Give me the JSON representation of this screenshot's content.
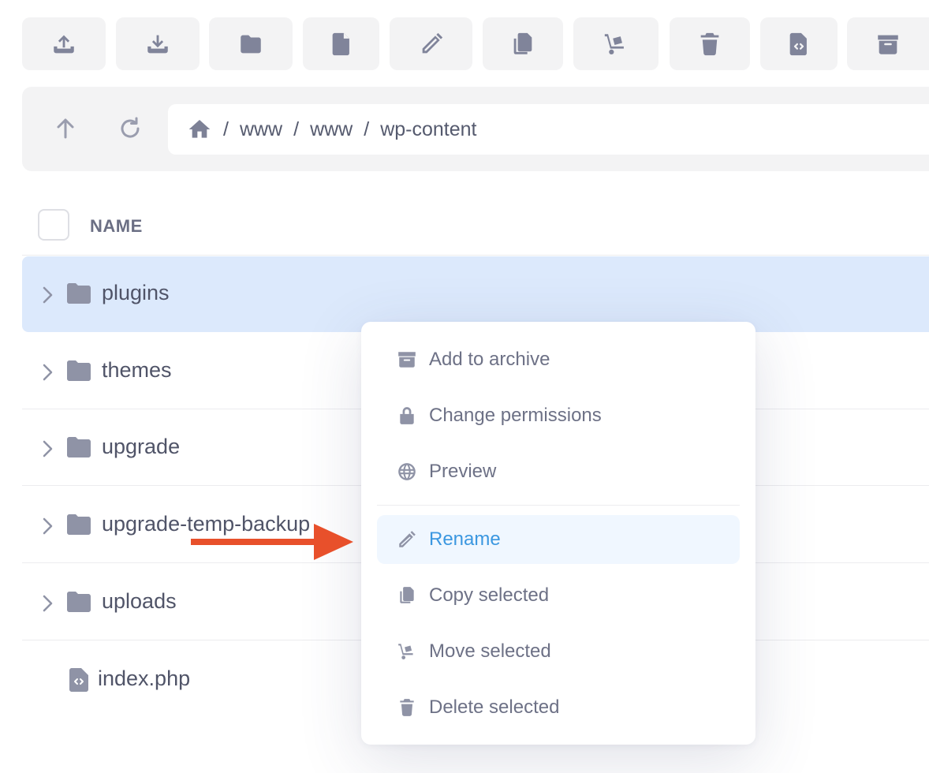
{
  "toolbar": {
    "buttons": [
      {
        "name": "upload-icon"
      },
      {
        "name": "download-icon"
      },
      {
        "name": "new-folder-icon"
      },
      {
        "name": "new-file-icon"
      },
      {
        "name": "rename-pencil-icon"
      },
      {
        "name": "copy-icon"
      },
      {
        "name": "move-dolly-icon"
      },
      {
        "name": "trash-icon"
      },
      {
        "name": "code-file-icon"
      },
      {
        "name": "archive-icon"
      }
    ],
    "icon_color": "#80849a",
    "button_bg": "#f3f3f4"
  },
  "address": {
    "crumbs": [
      "www",
      "www",
      "wp-content"
    ],
    "separator": "/"
  },
  "table": {
    "header_name": "NAME",
    "rows": [
      {
        "name": "plugins",
        "type": "folder",
        "selected": true
      },
      {
        "name": "themes",
        "type": "folder"
      },
      {
        "name": "upgrade",
        "type": "folder"
      },
      {
        "name": "upgrade-temp-backup",
        "type": "folder"
      },
      {
        "name": "uploads",
        "type": "folder"
      },
      {
        "name": "index.php",
        "type": "file"
      }
    ],
    "selected_bg": "#dce9fc"
  },
  "context_menu": {
    "items": [
      {
        "label": "Add to archive",
        "icon": "archive-icon"
      },
      {
        "label": "Change permissions",
        "icon": "lock-icon"
      },
      {
        "label": "Preview",
        "icon": "globe-icon"
      },
      {
        "label": "Rename",
        "icon": "pencil-icon",
        "active": true
      },
      {
        "label": "Copy selected",
        "icon": "copy-icon"
      },
      {
        "label": "Move selected",
        "icon": "dolly-icon"
      },
      {
        "label": "Delete selected",
        "icon": "trash-icon"
      }
    ],
    "active_color": "#3b97e0",
    "active_bg": "#f0f7ff"
  },
  "annotation": {
    "arrow_color": "#e8502b",
    "points_to": "Rename"
  }
}
